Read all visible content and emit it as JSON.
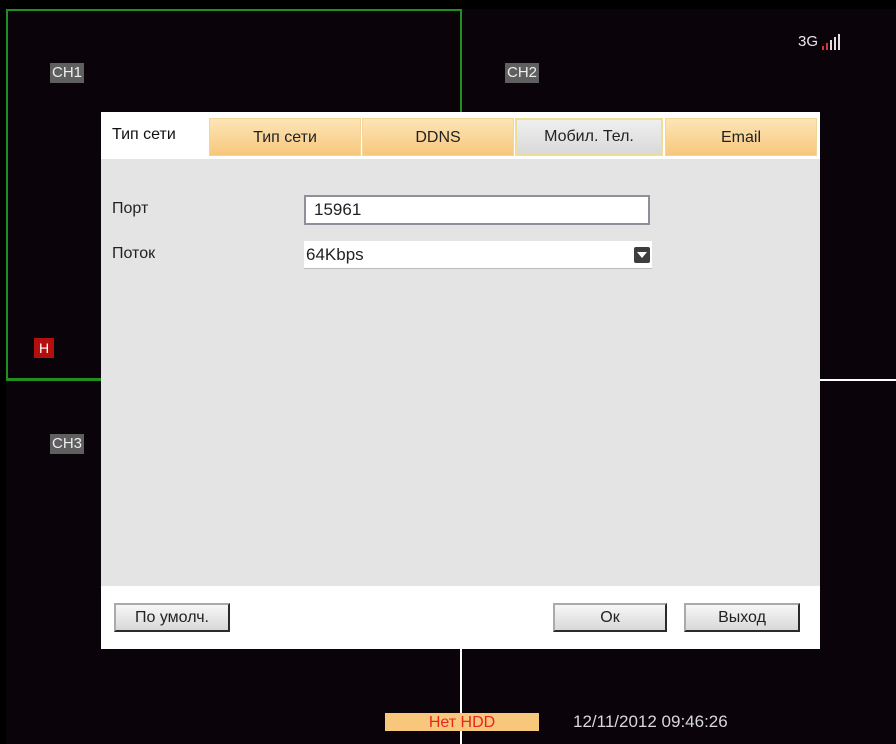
{
  "channels": {
    "ch1": "CH1",
    "ch2": "CH2",
    "ch3": "CH3",
    "h_badge": "H"
  },
  "signal": {
    "network": "3G",
    "strength_bars": 4
  },
  "dialog": {
    "title": "Тип сети",
    "tabs": [
      {
        "label": "Тип сети",
        "active": false
      },
      {
        "label": "DDNS",
        "active": false
      },
      {
        "label": "Мобил. Тел.",
        "active": true
      },
      {
        "label": "Email",
        "active": false
      }
    ],
    "fields": {
      "port_label": "Порт",
      "port_value": "15961",
      "stream_label": "Поток",
      "stream_value": "64Kbps"
    },
    "buttons": {
      "default_label": "По умолч.",
      "ok_label": "Ок",
      "exit_label": "Выход"
    }
  },
  "status_bar": {
    "hdd_status": "Нет HDD",
    "datetime": "12/11/2012 09:46:26"
  },
  "colors": {
    "tab_accent": "#f7c77c",
    "active_border": "#1f8f1f",
    "alert": "#e9271f"
  }
}
